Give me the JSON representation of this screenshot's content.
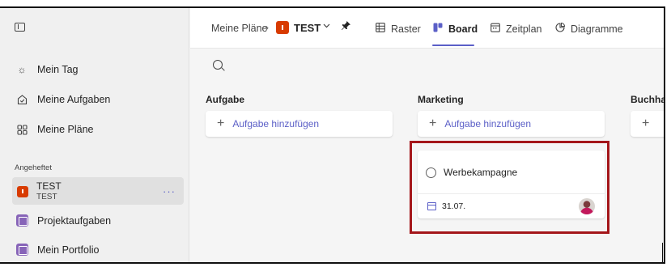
{
  "sidebar": {
    "items": [
      {
        "label": "Mein Tag",
        "icon": "sun-icon"
      },
      {
        "label": "Meine Aufgaben",
        "icon": "check-shield-icon"
      },
      {
        "label": "Meine Pläne",
        "icon": "grid-icon"
      }
    ],
    "section_label": "Angeheftet",
    "pinned": {
      "title": "TEST",
      "subtitle": "TEST",
      "more": "···"
    },
    "plans": [
      {
        "label": "Projektaufgaben"
      },
      {
        "label": "Mein Portfolio"
      }
    ]
  },
  "header": {
    "breadcrumb_root": "Meine Pläne",
    "plan_title": "TEST",
    "tabs": [
      {
        "label": "Raster",
        "icon": "grid-icon"
      },
      {
        "label": "Board",
        "icon": "board-icon",
        "active": true
      },
      {
        "label": "Zeitplan",
        "icon": "calendar-icon"
      },
      {
        "label": "Diagramme",
        "icon": "chart-icon"
      }
    ]
  },
  "board": {
    "columns": [
      {
        "title": "Aufgabe",
        "add_label": "Aufgabe hinzufügen"
      },
      {
        "title": "Marketing",
        "add_label": "Aufgabe hinzufügen"
      },
      {
        "title": "Buchha"
      }
    ],
    "task": {
      "name": "Werbekampagne",
      "due": "31.07."
    }
  },
  "colors": {
    "accent": "#5b5fc7",
    "plan_red": "#d83b01",
    "plan_purple": "#8764b8",
    "highlight": "#a4161a"
  }
}
